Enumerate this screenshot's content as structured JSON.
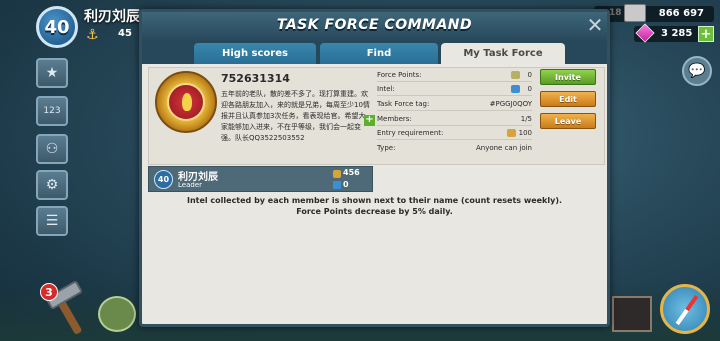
{
  "player": {
    "level": "40",
    "name": "利刃刘辰",
    "fp_fragment": "45"
  },
  "resources": {
    "gold_value": "866 697",
    "small_value": "18",
    "gems_value": "3 285",
    "gems_plus": "+"
  },
  "side_menu": [
    {
      "icon": "star-icon",
      "glyph": "★"
    },
    {
      "icon": "ranking-icon",
      "glyph": "123"
    },
    {
      "icon": "group-icon",
      "glyph": "⚇"
    },
    {
      "icon": "gears-icon",
      "glyph": "⚙"
    },
    {
      "icon": "list-icon",
      "glyph": "☰"
    }
  ],
  "bottom": {
    "hammer_count": "3"
  },
  "dialog": {
    "title": "TASK FORCE COMMAND",
    "close_glyph": "✕",
    "tabs": [
      {
        "label": "High scores",
        "active": false
      },
      {
        "label": "Find",
        "active": false
      },
      {
        "label": "My Task Force",
        "active": true
      }
    ],
    "task_force": {
      "name": "752631314",
      "description": "五年前的老队，散的差不多了。现打算重建。欢迎各路朋友加入，来的就是兄弟，每周至少10情报并且认真参加3次任务，看表现给官。希望大家能够加入进来，不在乎等级，我们会一起变强。队长QQ3522503552",
      "stats": [
        {
          "label": "Force Points:",
          "value": "0"
        },
        {
          "label": "Intel:",
          "value": "0"
        },
        {
          "label": "Task Force tag:",
          "value": "#PGGJ0QOY"
        },
        {
          "label": "Members:",
          "value": "1/5"
        },
        {
          "label": "Entry requirement:",
          "value": "100"
        },
        {
          "label": "Type:",
          "value": "Anyone can join"
        }
      ],
      "buttons": {
        "invite": "Invite",
        "edit": "Edit",
        "leave": "Leave"
      }
    },
    "members": [
      {
        "level": "40",
        "name": "利刃刘辰",
        "role": "Leader",
        "force_points": "456",
        "intel": "0"
      }
    ],
    "info_line1": "Intel collected by each member is shown next to their name (count resets weekly).",
    "info_line2": "Force Points decrease by 5% daily."
  }
}
